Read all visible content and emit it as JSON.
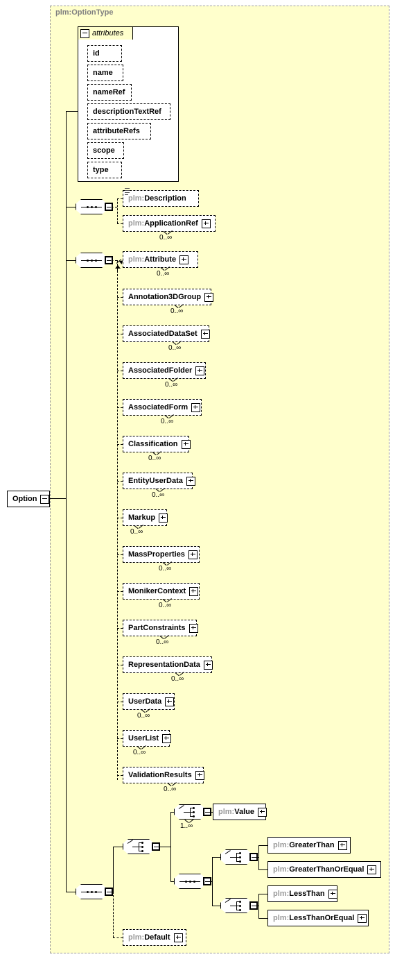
{
  "diagram": {
    "type_label": "plm:OptionType",
    "root_element": {
      "label": "Option"
    },
    "attributes_group": {
      "title": "attributes",
      "items": [
        {
          "name": "id"
        },
        {
          "name": "name"
        },
        {
          "name": "nameRef"
        },
        {
          "name": "descriptionTextRef"
        },
        {
          "name": "attributeRefs"
        },
        {
          "name": "scope"
        },
        {
          "name": "type"
        }
      ]
    },
    "occurrence": {
      "zero_unbounded": "0..∞",
      "one_unbounded": "1..∞"
    },
    "sequence_1": {
      "children": [
        {
          "label": "plm:Description",
          "ns": "plm:",
          "name": "Description",
          "style": "dashed",
          "expand": false,
          "occurs": ""
        },
        {
          "label": "plm:ApplicationRef",
          "ns": "plm:",
          "name": "ApplicationRef",
          "style": "dashed",
          "expand": true,
          "occurs": "0..∞"
        }
      ]
    },
    "sequence_2": {
      "children": [
        {
          "label": "plm:Attribute",
          "ns": "plm:",
          "name": "Attribute",
          "style": "dashed",
          "expand": true,
          "occurs": "0..∞"
        },
        {
          "label": "Annotation3DGroup",
          "ns": "",
          "name": "Annotation3DGroup",
          "style": "dashed",
          "expand": true,
          "occurs": "0..∞"
        },
        {
          "label": "AssociatedDataSet",
          "ns": "",
          "name": "AssociatedDataSet",
          "style": "dashed",
          "expand": true,
          "occurs": "0..∞"
        },
        {
          "label": "AssociatedFolder",
          "ns": "",
          "name": "AssociatedFolder",
          "style": "dashed",
          "expand": true,
          "occurs": "0..∞"
        },
        {
          "label": "AssociatedForm",
          "ns": "",
          "name": "AssociatedForm",
          "style": "dashed",
          "expand": true,
          "occurs": "0..∞"
        },
        {
          "label": "Classification",
          "ns": "",
          "name": "Classification",
          "style": "dashed",
          "expand": true,
          "occurs": "0..∞"
        },
        {
          "label": "EntityUserData",
          "ns": "",
          "name": "EntityUserData",
          "style": "dashed",
          "expand": true,
          "occurs": "0..∞"
        },
        {
          "label": "Markup",
          "ns": "",
          "name": "Markup",
          "style": "dashed",
          "expand": true,
          "occurs": "0..∞"
        },
        {
          "label": "MassProperties",
          "ns": "",
          "name": "MassProperties",
          "style": "dashed",
          "expand": true,
          "occurs": "0..∞"
        },
        {
          "label": "MonikerContext",
          "ns": "",
          "name": "MonikerContext",
          "style": "dashed",
          "expand": true,
          "occurs": "0..∞"
        },
        {
          "label": "PartConstraints",
          "ns": "",
          "name": "PartConstraints",
          "style": "dashed",
          "expand": true,
          "occurs": "0..∞"
        },
        {
          "label": "RepresentationData",
          "ns": "",
          "name": "RepresentationData",
          "style": "dashed",
          "expand": true,
          "occurs": "0..∞"
        },
        {
          "label": "UserData",
          "ns": "",
          "name": "UserData",
          "style": "dashed",
          "expand": true,
          "occurs": "0..∞"
        },
        {
          "label": "UserList",
          "ns": "",
          "name": "UserList",
          "style": "dashed",
          "expand": true,
          "occurs": "0..∞"
        },
        {
          "label": "ValidationResults",
          "ns": "",
          "name": "ValidationResults",
          "style": "dashed",
          "expand": true,
          "occurs": "0..∞"
        }
      ]
    },
    "sequence_3": {
      "value_choice_occurs": "1..∞",
      "children": [
        {
          "label": "plm:Value",
          "ns": "plm:",
          "name": "Value",
          "style": "solid",
          "expand": true
        },
        {
          "label": "plm:GreaterThan",
          "ns": "plm:",
          "name": "GreaterThan",
          "style": "solid",
          "expand": true
        },
        {
          "label": "plm:GreaterThanOrEqual",
          "ns": "plm:",
          "name": "GreaterThanOrEqual",
          "style": "solid",
          "expand": true
        },
        {
          "label": "plm:LessThan",
          "ns": "plm:",
          "name": "LessThan",
          "style": "solid",
          "expand": true
        },
        {
          "label": "plm:LessThanOrEqual",
          "ns": "plm:",
          "name": "LessThanOrEqual",
          "style": "solid",
          "expand": true
        },
        {
          "label": "plm:Default",
          "ns": "plm:",
          "name": "Default",
          "style": "dashed",
          "expand": true
        }
      ]
    },
    "colors": {
      "type_background": "#ffffcc",
      "node_background": "#ffffff",
      "shadow": "#c0c0c0",
      "namespace_text": "#999999",
      "line": "#000000"
    }
  }
}
